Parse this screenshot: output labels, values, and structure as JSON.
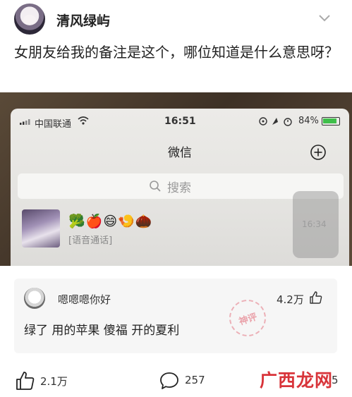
{
  "post": {
    "username": "清风绿屿",
    "text": "女朋友给我的备注是这个，哪位知道是什么意思呀？"
  },
  "phone": {
    "carrier": "中国联通",
    "time": "16:51",
    "battery": "84%",
    "app_title": "微信",
    "search_placeholder": "搜索",
    "chat_remark": "🥦🍎😄🍤🌰",
    "chat_last_message": "[语音通话]",
    "chat_time": "16:34"
  },
  "comment": {
    "username": "嗯嗯嗯你好",
    "likes": "4.2万",
    "text": "绿了 用的苹果 傻福 开的夏利",
    "stamp": "神评"
  },
  "footer": {
    "likes": "2.1万",
    "comments": "257",
    "shares": "5",
    "watermark": "广西龙网"
  },
  "colors": {
    "watermark": "#d8343a",
    "battery": "#3fbf4a"
  }
}
